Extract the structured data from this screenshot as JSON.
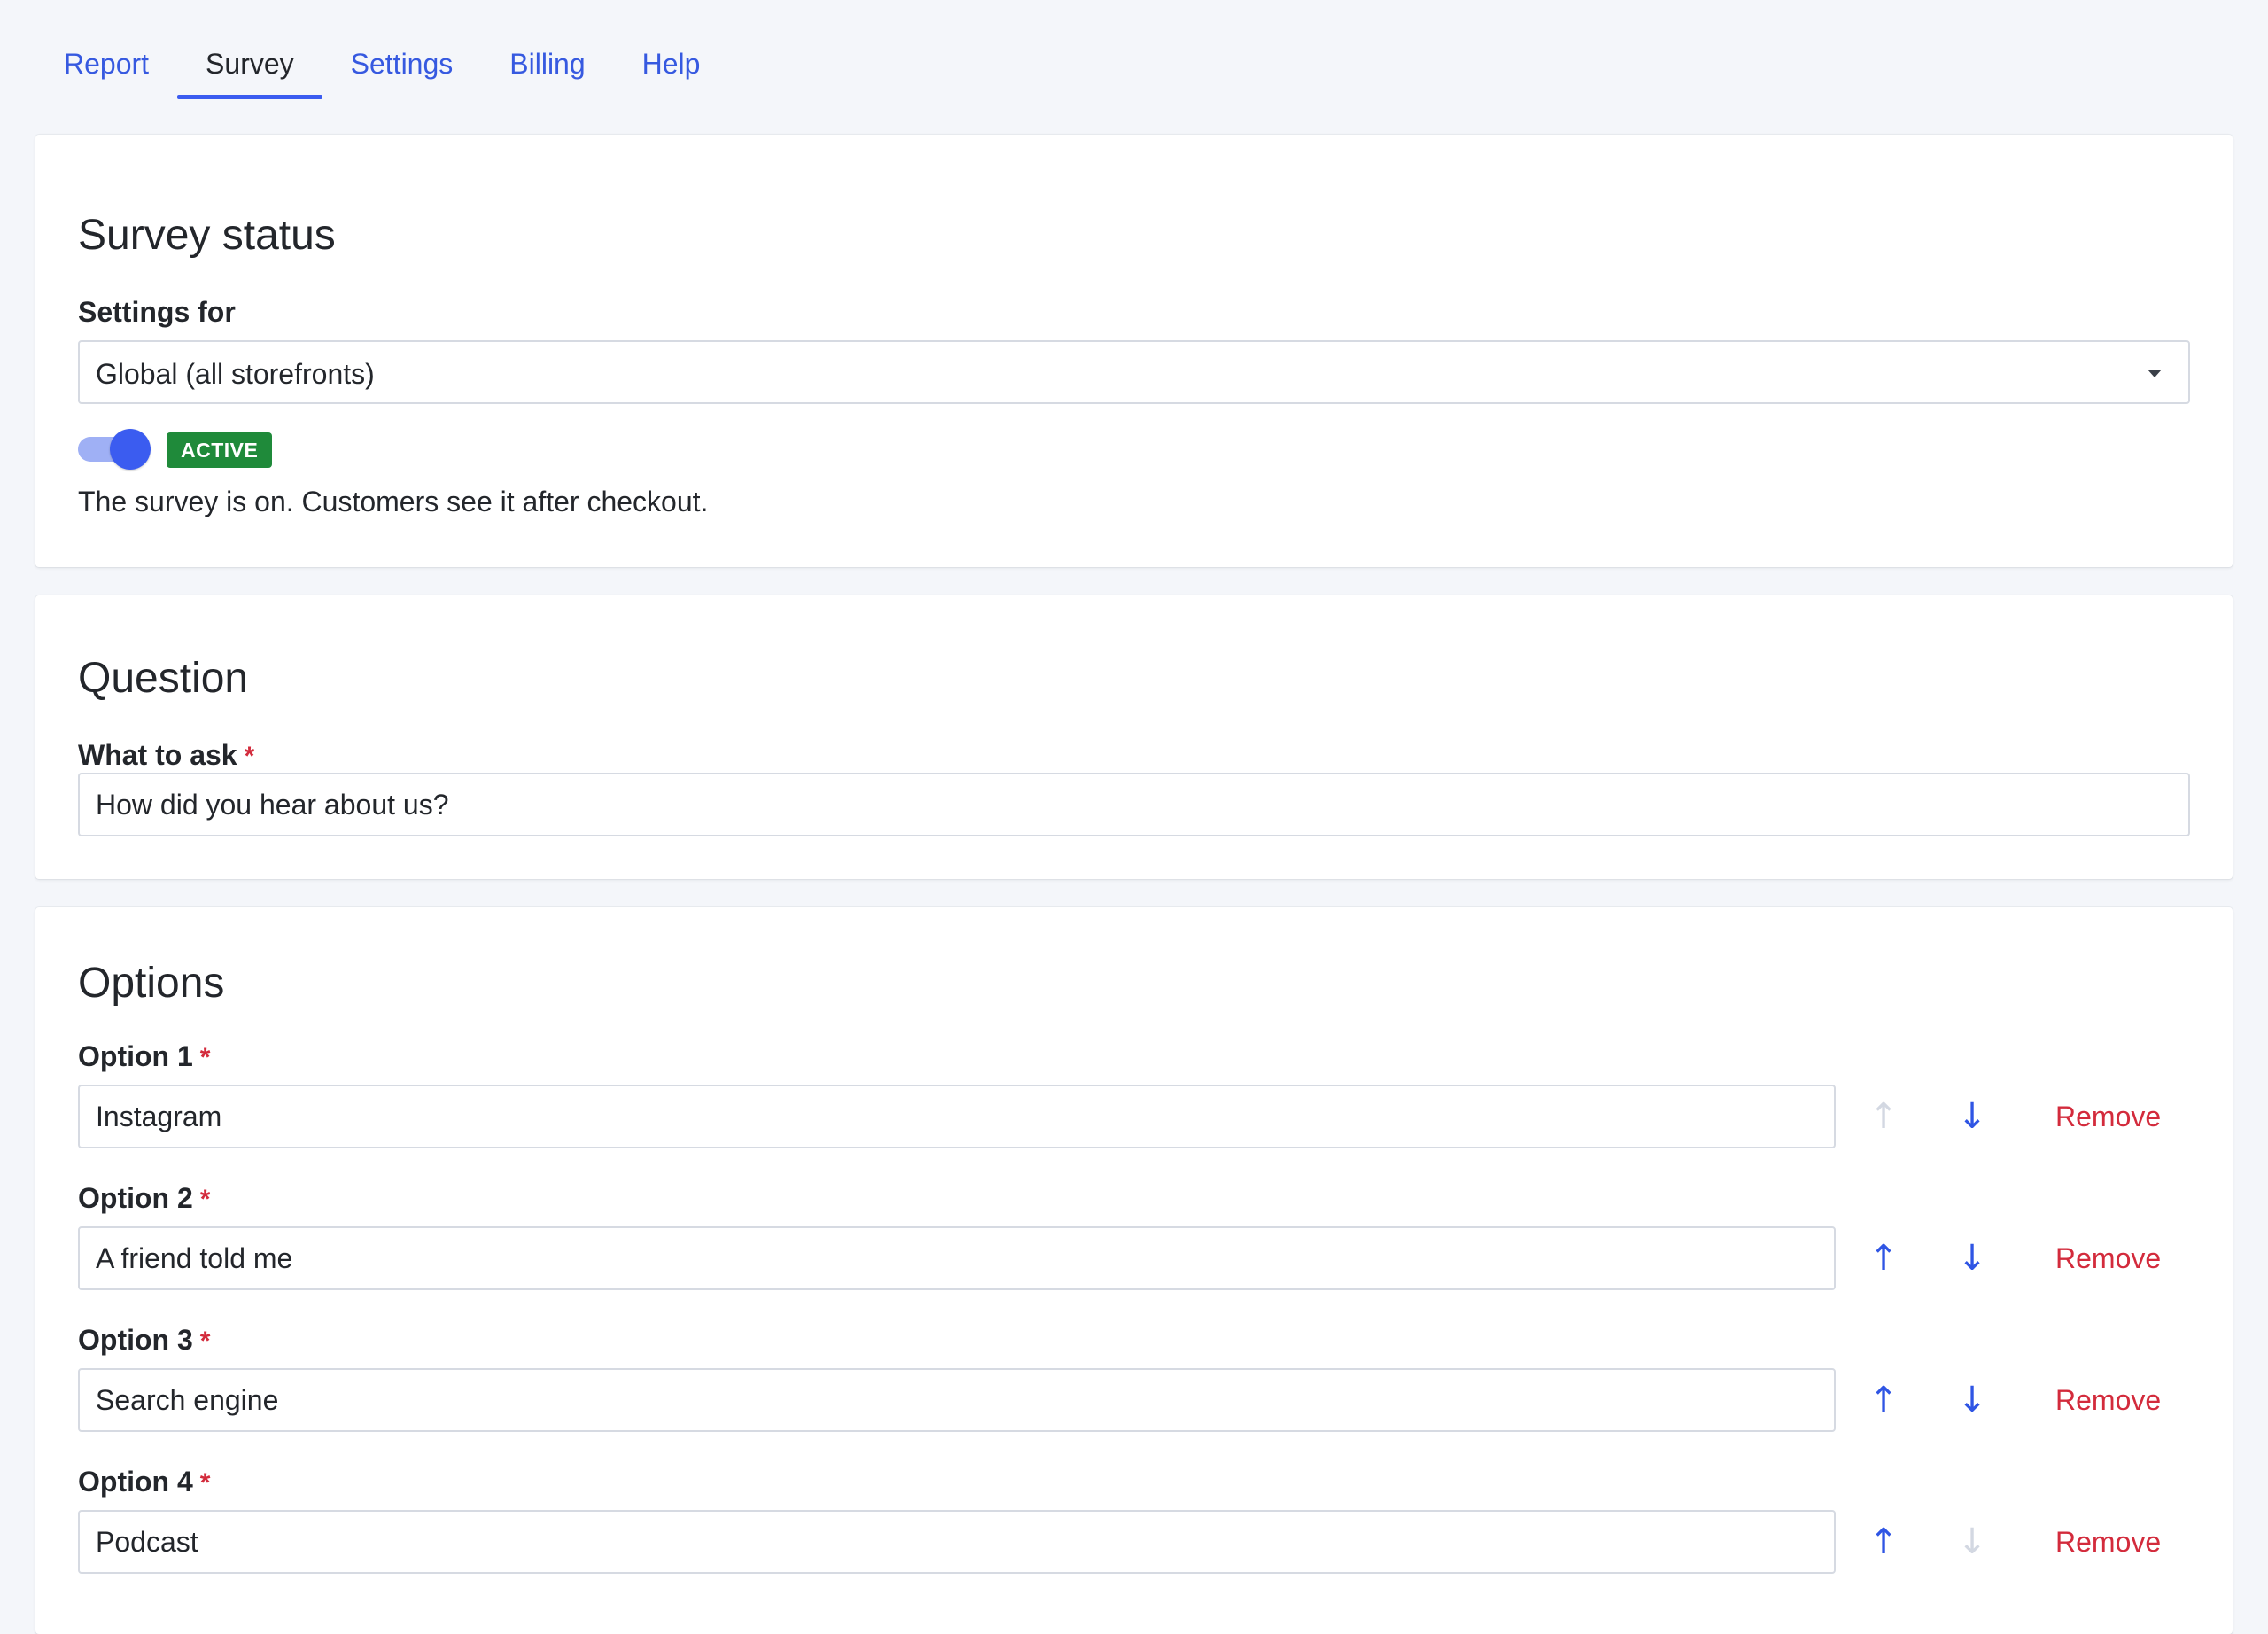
{
  "tabs": [
    {
      "label": "Report",
      "active": false
    },
    {
      "label": "Survey",
      "active": true
    },
    {
      "label": "Settings",
      "active": false
    },
    {
      "label": "Billing",
      "active": false
    },
    {
      "label": "Help",
      "active": false
    }
  ],
  "status_card": {
    "title": "Survey status",
    "settings_label": "Settings for",
    "settings_value": "Global (all storefronts)",
    "toggle_on": true,
    "badge": "ACTIVE",
    "description": "The survey is on. Customers see it after checkout."
  },
  "question_card": {
    "title": "Question",
    "label": "What to ask",
    "required_mark": "*",
    "value": "How did you hear about us?"
  },
  "options_card": {
    "title": "Options",
    "required_mark": "*",
    "remove_label": "Remove",
    "up_glyph": "↑",
    "down_glyph": "↓",
    "options": [
      {
        "label": "Option 1",
        "value": "Instagram",
        "up_enabled": false,
        "down_enabled": true
      },
      {
        "label": "Option 2",
        "value": "A friend told me",
        "up_enabled": true,
        "down_enabled": true
      },
      {
        "label": "Option 3",
        "value": "Search engine",
        "up_enabled": true,
        "down_enabled": true
      },
      {
        "label": "Option 4",
        "value": "Podcast",
        "up_enabled": true,
        "down_enabled": false
      }
    ]
  },
  "colors": {
    "accent": "#3b5cf0",
    "link": "#3659e0",
    "danger": "#d32b3c",
    "success": "#1f8a3a"
  }
}
